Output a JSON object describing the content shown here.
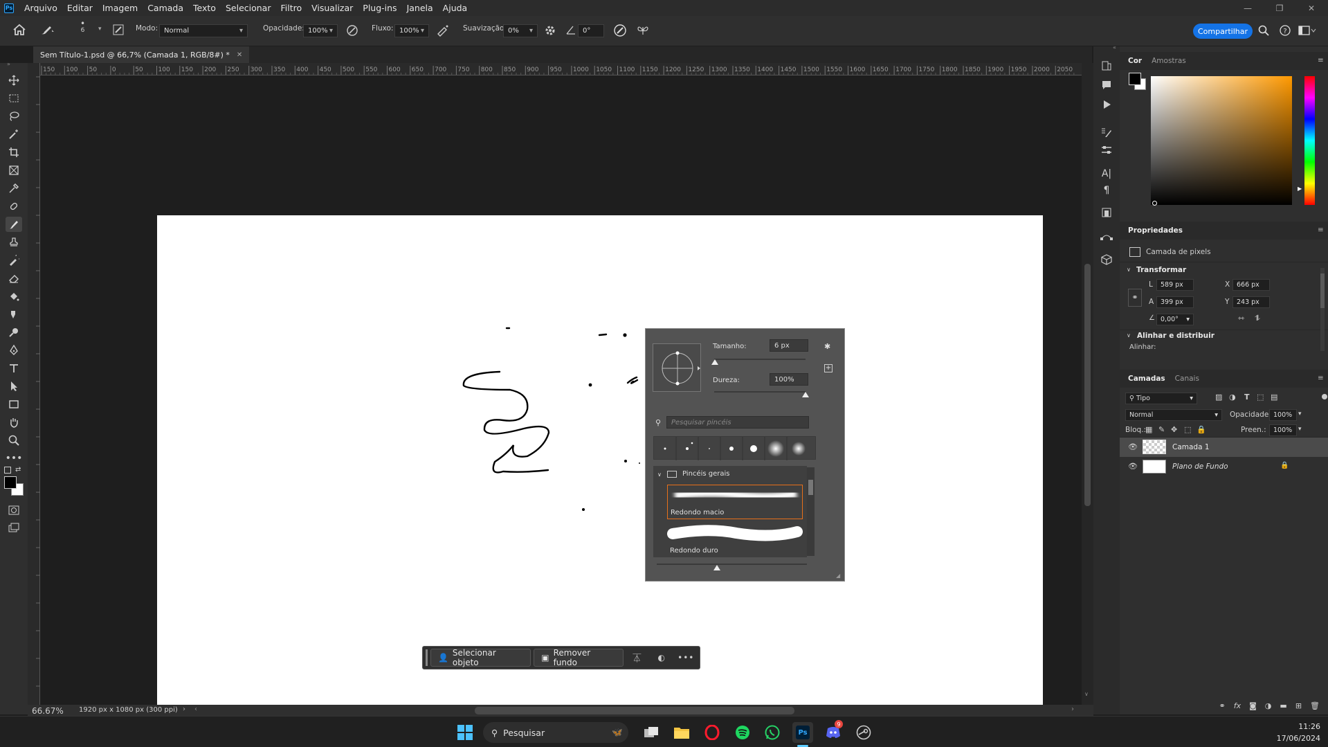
{
  "app": {
    "logo": "Ps"
  },
  "menu": [
    "Arquivo",
    "Editar",
    "Imagem",
    "Camada",
    "Texto",
    "Selecionar",
    "Filtro",
    "Visualizar",
    "Plug-ins",
    "Janela",
    "Ajuda"
  ],
  "options": {
    "brush_size": "6",
    "mode_label": "Modo:",
    "mode_value": "Normal",
    "opacity_label": "Opacidade:",
    "opacity_value": "100%",
    "flow_label": "Fluxo:",
    "flow_value": "100%",
    "smoothing_label": "Suavização:",
    "smoothing_value": "0%",
    "angle_value": "0°",
    "share_label": "Compartilhar"
  },
  "document": {
    "tab_title": "Sem Título-1.psd @ 66,7% (Camada 1, RGB/8#) *",
    "zoom": "66.67%",
    "doc_info": "1920 px x 1080 px (300 ppi)"
  },
  "ruler_labels": [
    "150",
    "100",
    "50",
    "0",
    "50",
    "100",
    "150",
    "200",
    "250",
    "300",
    "350",
    "400",
    "450",
    "500",
    "550",
    "600",
    "650",
    "700",
    "750",
    "800",
    "850",
    "900",
    "950",
    "1000",
    "1050",
    "1100",
    "1150",
    "1200",
    "1250",
    "1300",
    "1350",
    "1400",
    "1450",
    "1500",
    "1550",
    "1600",
    "1650",
    "1700",
    "1750",
    "1800",
    "1850",
    "1900",
    "1950",
    "2000",
    "2050"
  ],
  "brush_popup": {
    "size_label": "Tamanho:",
    "size_value": "6 px",
    "size_fraction": 0.01,
    "hardness_label": "Dureza:",
    "hardness_value": "100%",
    "hardness_fraction": 1.0,
    "search_placeholder": "Pesquisar pincéis",
    "folder": "Pincéis gerais",
    "brushes": [
      "Redondo macio",
      "Redondo duro"
    ]
  },
  "context_bar": {
    "select_object": "Selecionar objeto",
    "remove_bg": "Remover fundo"
  },
  "color_panel": {
    "tabs": [
      "Cor",
      "Amostras"
    ],
    "foreground": "#000000",
    "background": "#ffffff",
    "hue_color": "#ff9900"
  },
  "properties": {
    "title": "Propriedades",
    "kind": "Camada de pixels",
    "transform_label": "Transformar",
    "w_label": "L",
    "w_value": "589 px",
    "h_label": "A",
    "h_value": "399 px",
    "x_label": "X",
    "x_value": "666 px",
    "y_label": "Y",
    "y_value": "243 px",
    "angle_value": "0,00°",
    "align_label": "Alinhar e distribuir",
    "align_sub": "Alinhar:"
  },
  "layers_panel": {
    "tabs": [
      "Camadas",
      "Canais"
    ],
    "filter": "Tipo",
    "blend": "Normal",
    "opacity_label": "Opacidade:",
    "opacity_value": "100%",
    "lock_label": "Bloq.:",
    "fill_label": "Preen.:",
    "fill_value": "100%",
    "layers": [
      {
        "name": "Camada 1"
      },
      {
        "name": "Plano de Fundo"
      }
    ]
  },
  "taskbar": {
    "search": "Pesquisar",
    "time": "11:26",
    "date": "17/06/2024",
    "badge": "9"
  },
  "colors": {
    "accent": "#1473e6",
    "selection": "#e8701a"
  }
}
